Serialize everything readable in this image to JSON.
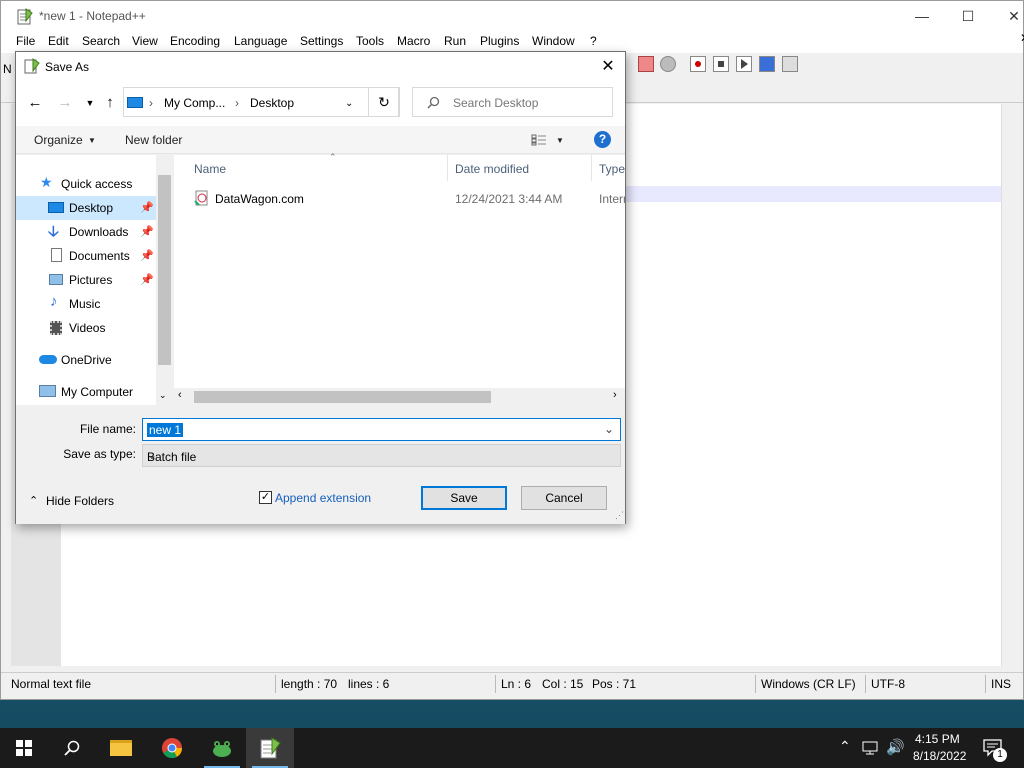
{
  "npp": {
    "title": "*new 1 - Notepad++",
    "menu": [
      "File",
      "Edit",
      "Search",
      "View",
      "Encoding",
      "Language",
      "Settings",
      "Tools",
      "Macro",
      "Run",
      "Plugins",
      "Window",
      "?"
    ],
    "side_letter": "N",
    "status": {
      "type": "Normal text file",
      "length": "length : 70",
      "lines": "lines : 6",
      "ln": "Ln : 6",
      "col": "Col : 15",
      "pos": "Pos : 71",
      "eol": "Windows (CR LF)",
      "enc": "UTF-8",
      "mode": "INS"
    }
  },
  "dialog": {
    "title": "Save As",
    "breadcrumb": [
      "My Comp...",
      "Desktop"
    ],
    "search_placeholder": "Search Desktop",
    "organize": "Organize",
    "new_folder": "New folder",
    "nav": [
      {
        "label": "Quick access",
        "icon": "star-icon",
        "pinned": false
      },
      {
        "label": "Desktop",
        "icon": "desktop-icon",
        "pinned": true,
        "selected": true
      },
      {
        "label": "Downloads",
        "icon": "download-icon",
        "pinned": true
      },
      {
        "label": "Documents",
        "icon": "document-icon",
        "pinned": true
      },
      {
        "label": "Pictures",
        "icon": "picture-icon",
        "pinned": true
      },
      {
        "label": "Music",
        "icon": "music-icon",
        "pinned": false
      },
      {
        "label": "Videos",
        "icon": "video-icon",
        "pinned": false
      },
      {
        "label": "OneDrive",
        "icon": "cloud-icon",
        "pinned": false
      },
      {
        "label": "My Computer",
        "icon": "computer-icon",
        "pinned": false
      }
    ],
    "columns": [
      "Name",
      "Date modified",
      "Type"
    ],
    "files": [
      {
        "name": "DataWagon.com",
        "date": "12/24/2021 3:44 AM",
        "type": "Intern"
      }
    ],
    "file_name_label": "File name:",
    "file_name_value": "new 1",
    "save_type_label": "Save as type:",
    "save_type_value": "Batch file",
    "hide_folders": "Hide Folders",
    "append_extension": "Append extension",
    "save": "Save",
    "cancel": "Cancel"
  },
  "clock": {
    "time": "4:15 PM",
    "date": "8/18/2022"
  },
  "notification_count": "1",
  "colors": {
    "accent": "#0078d7",
    "selected": "#cce8ff",
    "taskbar": "#1b1b1b"
  }
}
